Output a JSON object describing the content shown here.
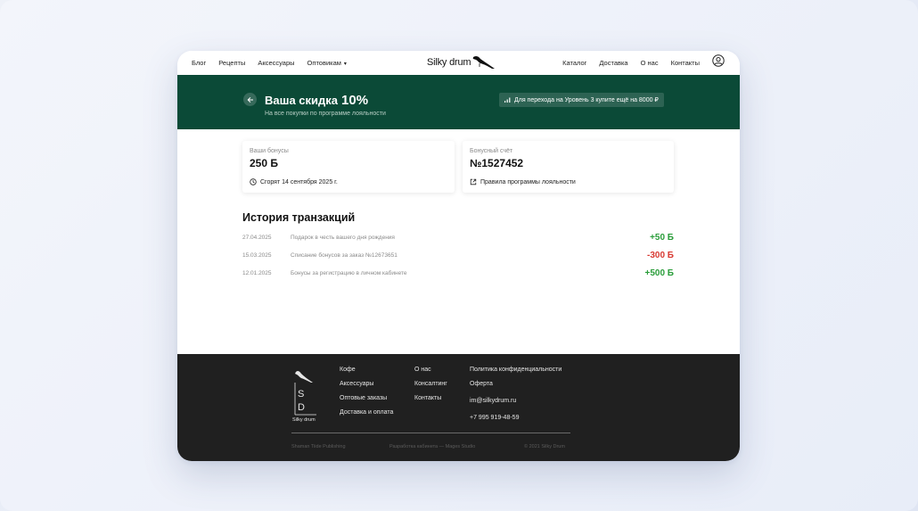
{
  "nav": {
    "left": [
      "Блог",
      "Рецепты",
      "Аксессуары",
      "Оптовикам"
    ],
    "right": [
      "Каталог",
      "Доставка",
      "О нас",
      "Контакты"
    ],
    "logo_text": "Silky drum"
  },
  "hero": {
    "title": "Ваша скидка",
    "discount": "10%",
    "subtitle": "На все покупки по программе лояльности",
    "badge": "Для перехода на Уровень 3 купите ещё на 8000 ₽"
  },
  "bonus_card": {
    "label": "Ваши бонусы",
    "value": "250 Б",
    "foot": "Сгорят 14 сентября 2025 г."
  },
  "account_card": {
    "label": "Бонусный счёт",
    "value": "№1527452",
    "foot": "Правила программы лояльности"
  },
  "transactions": {
    "title": "История транзакций",
    "rows": [
      {
        "date": "27.04.2025",
        "desc": "Подарок в честь вашего дня рождения",
        "amount": "+50 Б",
        "type": "plus"
      },
      {
        "date": "15.03.2025",
        "desc": "Списание бонусов за заказ №12673651",
        "amount": "-300 Б",
        "type": "minus"
      },
      {
        "date": "12.01.2025",
        "desc": "Бонусы за регистрацию в личном кабинете",
        "amount": "+500 Б",
        "type": "plus"
      }
    ]
  },
  "footer": {
    "logo_letters": "SD",
    "logo_text": "Silky drum",
    "col1": [
      "Кофе",
      "Аксессуары",
      "Оптовые заказы",
      "Доставка и оплата"
    ],
    "col2": [
      "О нас",
      "Консалтинг",
      "Контакты"
    ],
    "col3": [
      "Политика конфиденциальности",
      "Оферта",
      "im@silkydrum.ru",
      "+7 995 919-48-59"
    ],
    "bottom": [
      "Shaman Tiide Publishing",
      "Разработка кабинета — Mages Studio",
      "© 2021 Silky Drum"
    ]
  },
  "colors": {
    "hero_bg": "#0b4a37",
    "plus": "#2a9d3a",
    "minus": "#d83a32",
    "footer_bg": "#202020"
  }
}
